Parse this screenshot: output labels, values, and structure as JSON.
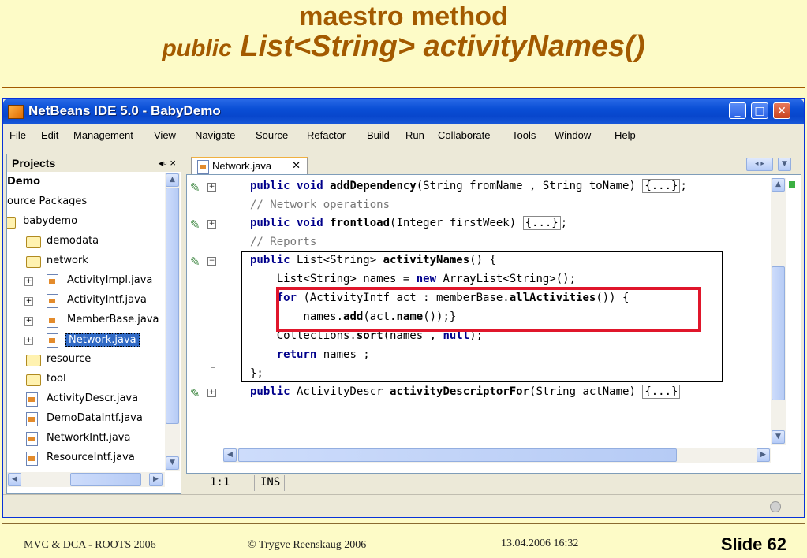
{
  "slide": {
    "title_line1": "maestro method",
    "title_line2_prefix": "public",
    "title_line2_main": "List<String> activityNames()",
    "footer_left": "MVC & DCA -  ROOTS 2006",
    "footer_center": "© Trygve Reenskaug 2006",
    "footer_date": "13.04.2006 16:32",
    "slide_number": "Slide 62"
  },
  "window": {
    "title": "NetBeans IDE 5.0 - BabyDemo",
    "controls": {
      "minimize": "_",
      "maximize": "□",
      "close": "✕"
    }
  },
  "menu": [
    "File",
    "Edit",
    "Management",
    "View",
    "Navigate",
    "Source",
    "Refactor",
    "Build",
    "Run",
    "Collaborate",
    "Tools",
    "Window",
    "Help"
  ],
  "projects": {
    "tab_label": "Projects",
    "tab_controls": "◂▫ ×",
    "tree": [
      {
        "label": "Demo",
        "bold": true
      },
      {
        "label": "ource Packages"
      },
      {
        "label": "babydemo"
      },
      {
        "label": "demodata"
      },
      {
        "label": "network"
      },
      {
        "label": "ActivityImpl.java"
      },
      {
        "label": "ActivityIntf.java"
      },
      {
        "label": "MemberBase.java"
      },
      {
        "label": "Network.java",
        "selected": true
      },
      {
        "label": "resource"
      },
      {
        "label": "tool"
      },
      {
        "label": "ActivityDescr.java"
      },
      {
        "label": "DemoDataIntf.java"
      },
      {
        "label": "NetworkIntf.java"
      },
      {
        "label": "ResourceIntf.java"
      }
    ]
  },
  "editor": {
    "tab_label": "Network.java",
    "tab_close": "✕",
    "status_position": "1:1",
    "status_mode": "INS"
  }
}
